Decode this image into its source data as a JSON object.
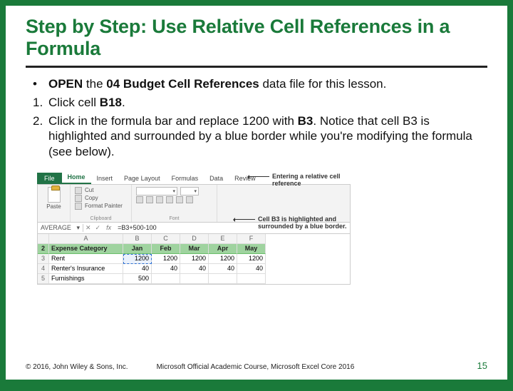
{
  "title": "Step by Step: Use Relative Cell References in a Formula",
  "steps": {
    "bullet": {
      "marker": "•",
      "pre": "OPEN",
      "mid": " the ",
      "file": "04 Budget Cell References",
      "post": " data file for this lesson."
    },
    "s1": {
      "marker": "1.",
      "pre": "Click cell ",
      "cell": "B18",
      "post": "."
    },
    "s2": {
      "marker": "2.",
      "a": "Click in the formula bar and replace 1200 with ",
      "ref": "B3",
      "b": ". Notice that cell B3 is highlighted and surrounded by a blue border while you're modifying the formula (see below)."
    }
  },
  "excel": {
    "tabs": {
      "file": "File",
      "home": "Home",
      "insert": "Insert",
      "pagelayout": "Page Layout",
      "formulas": "Formulas",
      "data": "Data",
      "review": "Review"
    },
    "clipboard": {
      "paste": "Paste",
      "cut": "Cut",
      "copy": "Copy",
      "fpainter": "Format Painter",
      "label": "Clipboard"
    },
    "fontgroup": {
      "label": "Font"
    },
    "namebox": "AVERAGE",
    "fx": "fx",
    "formula": "=B3+500-100",
    "headers": [
      "",
      "A",
      "B",
      "C",
      "D",
      "E",
      "F"
    ],
    "rows": [
      {
        "n": "2",
        "a": "Expense Category",
        "v": [
          "Jan",
          "Feb",
          "Mar",
          "Apr",
          "May"
        ],
        "hdr": true
      },
      {
        "n": "3",
        "a": "Rent",
        "v": [
          "1200",
          "1200",
          "1200",
          "1200",
          "1200"
        ],
        "sel": 0
      },
      {
        "n": "4",
        "a": "Renter's Insurance",
        "v": [
          "40",
          "40",
          "40",
          "40",
          "40"
        ]
      },
      {
        "n": "5",
        "a": "Furnishings",
        "v": [
          "500",
          "",
          "",
          "",
          ""
        ]
      }
    ]
  },
  "callouts": {
    "c1": "Entering a relative cell reference",
    "c2": "Cell B3 is highlighted and surrounded by a blue border."
  },
  "footer": {
    "copyright": "© 2016, John Wiley & Sons, Inc.",
    "course": "Microsoft Official Academic Course, Microsoft Excel Core 2016",
    "page": "15"
  }
}
